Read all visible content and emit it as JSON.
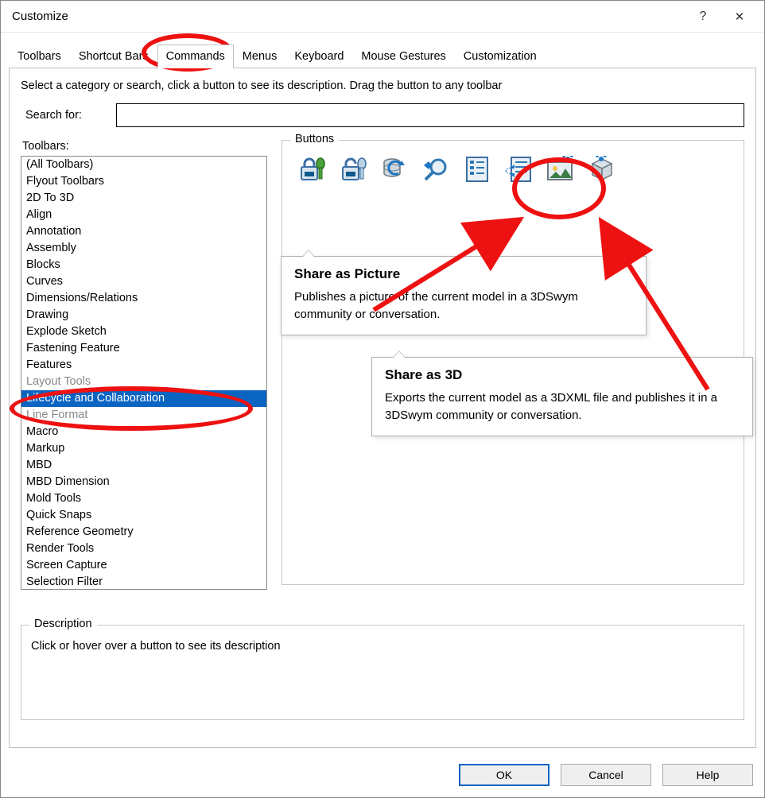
{
  "window": {
    "title": "Customize",
    "help_glyph": "?",
    "close_glyph": "✕"
  },
  "tabs": [
    {
      "label": "Toolbars"
    },
    {
      "label": "Shortcut Bars"
    },
    {
      "label": "Commands",
      "active": true
    },
    {
      "label": "Menus"
    },
    {
      "label": "Keyboard"
    },
    {
      "label": "Mouse Gestures"
    },
    {
      "label": "Customization"
    }
  ],
  "intro": "Select a category or search, click a button to see its description. Drag the button to any toolbar",
  "search": {
    "label": "Search for:",
    "value": ""
  },
  "toolbars": {
    "label": "Toolbars:",
    "items": [
      "(All Toolbars)",
      "Flyout Toolbars",
      "2D To 3D",
      "Align",
      "Annotation",
      "Assembly",
      "Blocks",
      "Curves",
      "Dimensions/Relations",
      "Drawing",
      "Explode Sketch",
      "Fastening Feature",
      "Features",
      "Layout Tools",
      "Lifecycle and Collaboration",
      "Line Format",
      "Macro",
      "Markup",
      "MBD",
      "MBD Dimension",
      "Mold Tools",
      "Quick Snaps",
      "Reference Geometry",
      "Render Tools",
      "Screen Capture",
      "Selection Filter"
    ],
    "selected_index": 14
  },
  "buttons_panel": {
    "legend": "Buttons",
    "icons": [
      "lock-key-icon",
      "unlock-key-icon",
      "database-refresh-icon",
      "search-icon",
      "list-icon",
      "list-arrow-icon",
      "share-picture-icon",
      "share-3d-icon"
    ]
  },
  "tooltip1": {
    "title": "Share as Picture",
    "body": "Publishes a picture of the current model in a 3DSwym community or conversation."
  },
  "tooltip2": {
    "title": "Share as 3D",
    "body": "Exports the current model as a 3DXML file and publishes it in a 3DSwym community or conversation."
  },
  "description": {
    "legend": "Description",
    "text": "Click or hover over a button to see its description"
  },
  "footer": {
    "ok": "OK",
    "cancel": "Cancel",
    "help": "Help"
  }
}
